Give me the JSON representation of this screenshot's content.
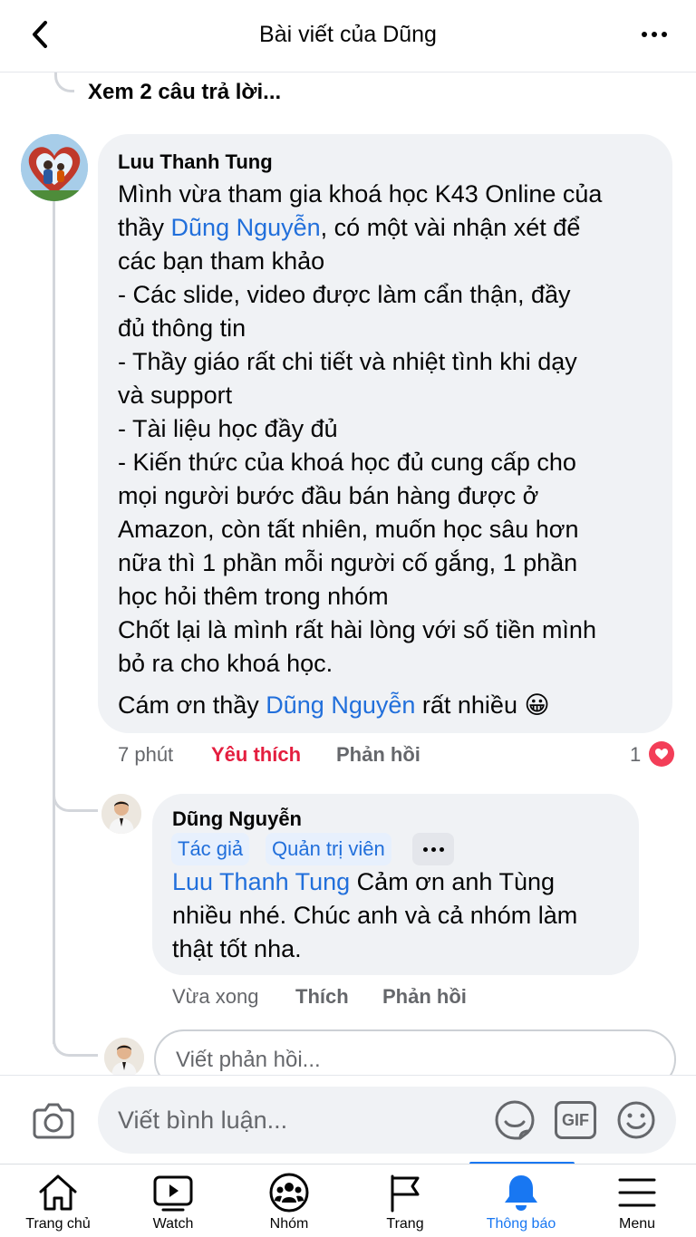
{
  "header": {
    "title": "Bài viết của Dũng"
  },
  "thread": {
    "view_replies": "Xem 2 câu trả lời..."
  },
  "comment": {
    "author": "Luu Thanh Tung",
    "lines": [
      {
        "text": "Mình vừa tham gia khoá học K43 Online của"
      },
      {
        "pre": "thầy ",
        "mention": "Dũng Nguyễn",
        "post": ", có một vài nhận xét để"
      },
      {
        "text": "các bạn tham khảo"
      },
      {
        "text": "- Các slide, video được làm cẩn thận, đầy"
      },
      {
        "text": "đủ thông tin"
      },
      {
        "text": "- Thầy giáo rất chi tiết và nhiệt tình khi dạy"
      },
      {
        "text": "và support"
      },
      {
        "text": "- Tài liệu học đầy đủ"
      },
      {
        "text": "- Kiến thức của khoá học đủ cung cấp cho"
      },
      {
        "text": "mọi người bước đầu bán hàng được ở"
      },
      {
        "text": "Amazon, còn tất nhiên, muốn học sâu hơn"
      },
      {
        "text": "nữa thì 1 phần mỗi người cố gắng, 1 phần"
      },
      {
        "text": "học hỏi thêm trong nhóm"
      },
      {
        "text": "Chốt lại là mình rất hài lòng với số tiền mình"
      },
      {
        "text": "bỏ ra cho khoá học."
      }
    ],
    "last_line": {
      "pre": "Cám ơn thầy ",
      "mention": "Dũng Nguyễn",
      "post": " rất nhiều",
      "emoji": "😀"
    },
    "time": "7 phút",
    "like_label": "Yêu thích",
    "reply_label": "Phản hồi",
    "reaction_count": "1"
  },
  "reply": {
    "author": "Dũng Nguyễn",
    "badges": [
      "Tác giả",
      "Quản trị viên"
    ],
    "lines": [
      {
        "mention": "Luu Thanh Tung",
        "post": " Cảm ơn anh Tùng"
      },
      {
        "text": "nhiều nhé. Chúc anh và cả nhóm làm"
      },
      {
        "text": "thật tốt nha."
      }
    ],
    "time": "Vừa xong",
    "like_label": "Thích",
    "reply_label": "Phản hồi"
  },
  "reply_input": {
    "placeholder": "Viết phản hồi..."
  },
  "composer": {
    "placeholder": "Viết bình luận...",
    "gif_label": "GIF"
  },
  "bottom_nav": {
    "items": [
      {
        "label": "Trang chủ",
        "icon": "home-icon"
      },
      {
        "label": "Watch",
        "icon": "watch-icon"
      },
      {
        "label": "Nhóm",
        "icon": "groups-icon"
      },
      {
        "label": "Trang",
        "icon": "pages-flag-icon"
      },
      {
        "label": "Thông báo",
        "icon": "bell-icon",
        "active": true
      },
      {
        "label": "Menu",
        "icon": "menu-icon"
      }
    ]
  },
  "colors": {
    "accent": "#1877f2",
    "mention": "#216fdb",
    "love": "#e41e3f",
    "bubble": "#f0f2f5"
  }
}
